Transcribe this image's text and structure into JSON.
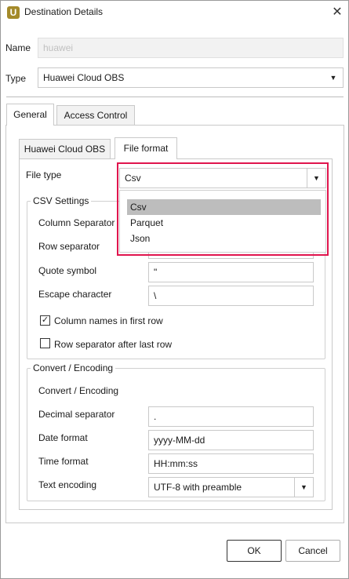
{
  "window": {
    "title": "Destination Details",
    "app_icon_letter": "U",
    "close_glyph": "✕"
  },
  "name_field": {
    "label": "Name",
    "value": "huawei"
  },
  "type_field": {
    "label": "Type",
    "value": "Huawei Cloud OBS"
  },
  "tabs": [
    {
      "label": "General",
      "active": true
    },
    {
      "label": "Access Control",
      "active": false
    }
  ],
  "subtabs": [
    {
      "label": "Huawei Cloud OBS",
      "active": false
    },
    {
      "label": "File format",
      "active": true
    }
  ],
  "file_type": {
    "label": "File type",
    "value": "Csv",
    "options": [
      "Csv",
      "Parquet",
      "Json"
    ],
    "selected_index": 0,
    "highlight_color": "#e0154d"
  },
  "csv_settings": {
    "title": "CSV Settings",
    "column_separator_label": "Column Separator",
    "row_separator_label": "Row separator",
    "quote_symbol_label": "Quote symbol",
    "quote_symbol_value": "\"",
    "escape_character_label": "Escape character",
    "escape_character_value": "\\",
    "column_names_label": "Column names in first row",
    "column_names_checked": true,
    "row_sep_after_last_label": "Row separator after last row",
    "row_sep_after_last_checked": false
  },
  "convert_encoding": {
    "title": "Convert / Encoding",
    "subtitle": "Convert / Encoding",
    "decimal_separator_label": "Decimal separator",
    "decimal_separator_value": ".",
    "date_format_label": "Date format",
    "date_format_value": "yyyy-MM-dd",
    "time_format_label": "Time format",
    "time_format_value": "HH:mm:ss",
    "text_encoding_label": "Text encoding",
    "text_encoding_value": "UTF-8 with preamble"
  },
  "buttons": {
    "ok": "OK",
    "cancel": "Cancel"
  },
  "icons": {
    "dropdown_arrow": "▼",
    "check": "✓"
  }
}
